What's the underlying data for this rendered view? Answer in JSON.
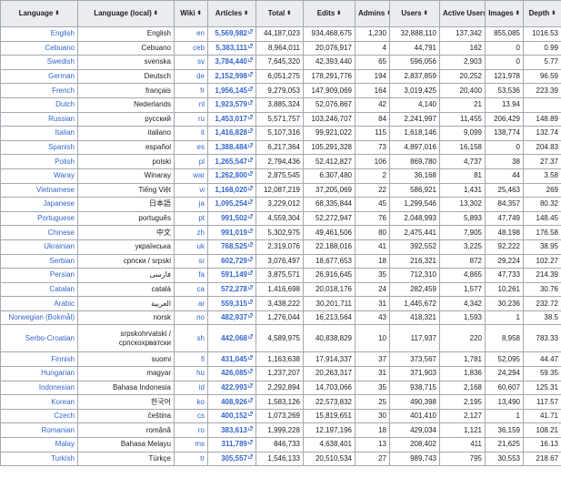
{
  "table": {
    "headers": [
      "Language",
      "Language (local)",
      "Wiki",
      "Articles",
      "Total",
      "Edits",
      "Admins",
      "Users",
      "Active Users",
      "Images",
      "Depth"
    ],
    "sort_icon": "sort-icon",
    "rows": [
      [
        "English",
        "English",
        "en",
        "5,569,982",
        "44,187,023",
        "934,468,675",
        "1,230",
        "32,888,110",
        "137,342",
        "855,085",
        "1016.53"
      ],
      [
        "Cebuano",
        "Cebuano",
        "ceb",
        "5,383,111",
        "8,964,011",
        "20,076,917",
        "4",
        "44,791",
        "162",
        "0",
        "0.99"
      ],
      [
        "Swedish",
        "svenska",
        "sv",
        "3,784,440",
        "7,645,320",
        "42,393,440",
        "65",
        "596,056",
        "2,903",
        "0",
        "5.77"
      ],
      [
        "German",
        "Deutsch",
        "de",
        "2,152,998",
        "6,051,275",
        "178,291,776",
        "194",
        "2,837,859",
        "20,252",
        "121,978",
        "96.59"
      ],
      [
        "French",
        "français",
        "fr",
        "1,956,145",
        "9,279,053",
        "147,909,069",
        "164",
        "3,019,425",
        "20,400",
        "53,536",
        "223.39"
      ],
      [
        "Dutch",
        "Nederlands",
        "nl",
        "1,923,579",
        "3,885,324",
        "52,076,867",
        "42",
        "4,140",
        "21",
        "13.94",
        ""
      ],
      [
        "Russian",
        "русский",
        "ru",
        "1,453,017",
        "5,571,757",
        "103,246,707",
        "84",
        "2,241,997",
        "11,455",
        "206,429",
        "148.89"
      ],
      [
        "Italian",
        "italiano",
        "it",
        "1,416,828",
        "5,107,316",
        "99,921,022",
        "115",
        "1,618,146",
        "9,099",
        "138,774",
        "132.74"
      ],
      [
        "Spanish",
        "español",
        "es",
        "1,388,484",
        "6,217,364",
        "105,291,328",
        "73",
        "4,897,016",
        "16,158",
        "0",
        "204.83"
      ],
      [
        "Polish",
        "polski",
        "pl",
        "1,265,547",
        "2,794,436",
        "52,412,827",
        "106",
        "869,780",
        "4,737",
        "38",
        "27.37"
      ],
      [
        "Waray",
        "Winaray",
        "war",
        "1,262,800",
        "2,875,545",
        "6,307,480",
        "2",
        "36,168",
        "81",
        "44",
        "3.58"
      ],
      [
        "Vietnamese",
        "Tiếng Việt",
        "vi",
        "1,168,020",
        "12,087,219",
        "37,205,069",
        "22",
        "586,921",
        "1,431",
        "25,463",
        "269"
      ],
      [
        "Japanese",
        "日本語",
        "ja",
        "1,095,254",
        "3,229,012",
        "68,335,844",
        "45",
        "1,299,546",
        "13,302",
        "84,357",
        "80.32"
      ],
      [
        "Portuguese",
        "português",
        "pt",
        "991,502",
        "4,559,304",
        "52,272,947",
        "76",
        "2,048,993",
        "5,893",
        "47,749",
        "148.45"
      ],
      [
        "Chinese",
        "中文",
        "zh",
        "991,019",
        "5,302,975",
        "49,461,506",
        "80",
        "2,475,441",
        "7,905",
        "48,198",
        "176.58"
      ],
      [
        "Ukrainian",
        "українська",
        "uk",
        "768,525",
        "2,319,076",
        "22,188,016",
        "41",
        "392,552",
        "3,225",
        "92,222",
        "38.95"
      ],
      [
        "Serbian",
        "српски / srpski",
        "sr",
        "602,729",
        "3,076,497",
        "18,677,653",
        "18",
        "216,321",
        "872",
        "29,224",
        "102.27"
      ],
      [
        "Persian",
        "فارسی",
        "fa",
        "591,149",
        "3,875,571",
        "26,916,645",
        "35",
        "712,310",
        "4,865",
        "47,733",
        "214.39"
      ],
      [
        "Catalan",
        "català",
        "ca",
        "572,278",
        "1,416,698",
        "20,018,176",
        "24",
        "282,459",
        "1,577",
        "10,261",
        "30.76"
      ],
      [
        "Arabic",
        "العربية",
        "ar",
        "559,315",
        "3,438,222",
        "30,201,711",
        "31",
        "1,445,672",
        "4,342",
        "30,236",
        "232.72"
      ],
      [
        "Norwegian (Bokmål)",
        "norsk",
        "no",
        "482,937",
        "1,276,044",
        "16,213,564",
        "43",
        "418,321",
        "1,593",
        "1",
        "38.5"
      ],
      [
        "Serbo-Croatian",
        "srpskohrvatski / српскохрватски",
        "sh",
        "442,068",
        "4,589,975",
        "40,838,829",
        "10",
        "117,937",
        "220",
        "8,958",
        "783.33"
      ],
      [
        "Finnish",
        "suomi",
        "fi",
        "431,045",
        "1,163,638",
        "17,914,337",
        "37",
        "373,567",
        "1,781",
        "52,095",
        "44.47"
      ],
      [
        "Hungarian",
        "magyar",
        "hu",
        "426,085",
        "1,237,207",
        "20,263,317",
        "31",
        "371,903",
        "1,836",
        "24,294",
        "59.35"
      ],
      [
        "Indonesian",
        "Bahasa Indonesia",
        "id",
        "422,993",
        "2,292,894",
        "14,703,066",
        "35",
        "938,715",
        "2,168",
        "60,607",
        "125.31"
      ],
      [
        "Korean",
        "한국어",
        "ko",
        "408,926",
        "1,583,126",
        "22,573,832",
        "25",
        "490,398",
        "2,195",
        "13,490",
        "117.57"
      ],
      [
        "Czech",
        "čeština",
        "cs",
        "400,152",
        "1,073,269",
        "15,819,651",
        "30",
        "401,410",
        "2,127",
        "1",
        "41.71"
      ],
      [
        "Romanian",
        "română",
        "ro",
        "383,613",
        "1,999,228",
        "12,197,196",
        "18",
        "429,034",
        "1,121",
        "36,159",
        "108.21"
      ],
      [
        "Malay",
        "Bahasa Melayu",
        "ms",
        "311,789",
        "846,733",
        "4,638,401",
        "13",
        "208,402",
        "411",
        "21,625",
        "16.13"
      ],
      [
        "Turkish",
        "Türkçe",
        "tr",
        "305,557",
        "1,546,133",
        "20,510,534",
        "27",
        "989,743",
        "795",
        "30,553",
        "218.67"
      ]
    ]
  },
  "colors": {
    "link": "#3366cc",
    "header_bg": "#eaecf0",
    "border": "#a2a9b1"
  },
  "external_link_icon": "external-link-icon"
}
